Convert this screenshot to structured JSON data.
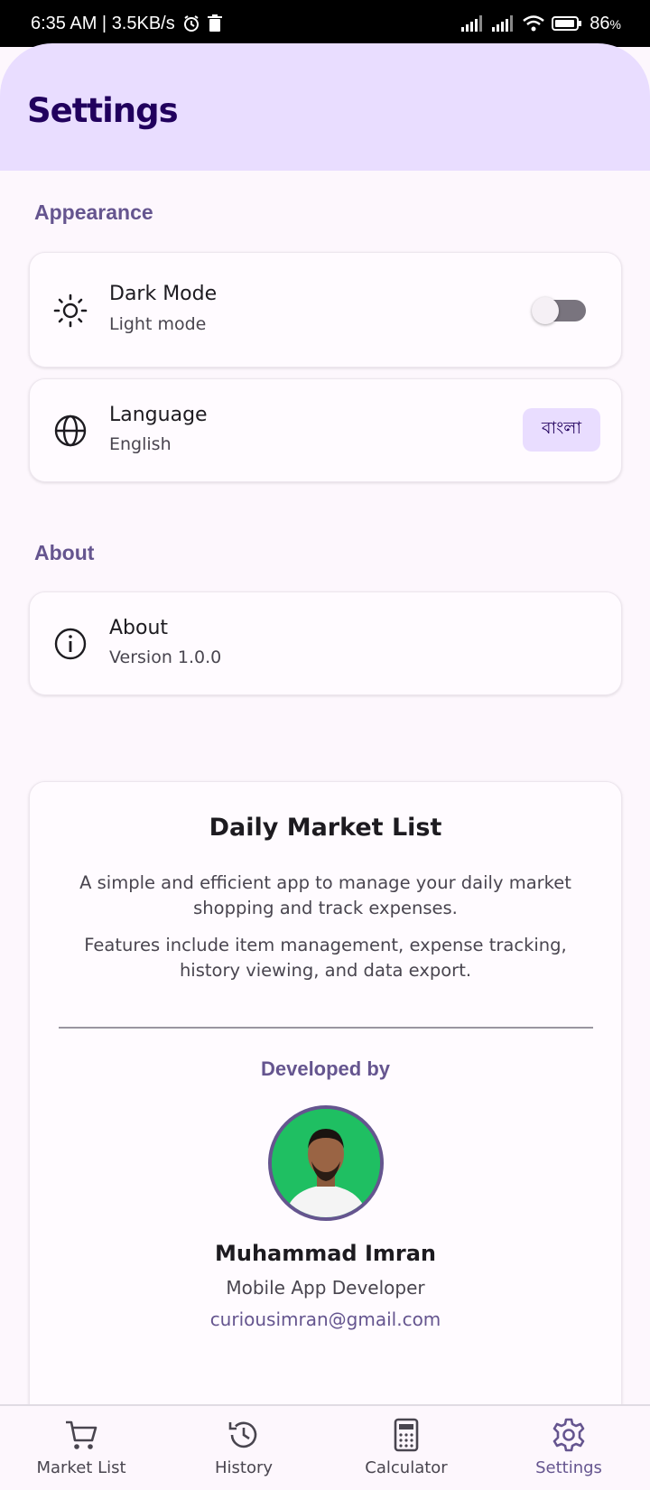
{
  "status_bar": {
    "time_speed": "6:35 AM | 3.5KB/s",
    "battery": "86"
  },
  "header": {
    "title": "Settings"
  },
  "appearance": {
    "section_title": "Appearance",
    "dark_mode": {
      "title": "Dark Mode",
      "subtitle": "Light mode",
      "icon": "sun-icon",
      "enabled": false
    },
    "language": {
      "title": "Language",
      "subtitle": "English",
      "icon": "globe-icon",
      "chip": "বাংলা"
    }
  },
  "about_section": {
    "section_title": "About",
    "about_row": {
      "title": "About",
      "subtitle": "Version 1.0.0",
      "icon": "info-icon"
    }
  },
  "app_card": {
    "name": "Daily Market List",
    "description_1": "A simple and efficient app to manage your daily market shopping and track expenses.",
    "description_2": "Features include item management, expense tracking, history viewing, and data export.",
    "developed_by": "Developed by",
    "developer_name": "Muhammad Imran",
    "developer_role": "Mobile App Developer",
    "developer_email": "curiousimran@gmail.com"
  },
  "bottom_nav": {
    "items": [
      {
        "label": "Market List",
        "icon": "cart-icon"
      },
      {
        "label": "History",
        "icon": "history-icon"
      },
      {
        "label": "Calculator",
        "icon": "calculator-icon"
      },
      {
        "label": "Settings",
        "icon": "gear-icon"
      }
    ],
    "active": "Settings"
  },
  "colors": {
    "accent": "#65558f",
    "header_bg": "#e9ddff",
    "title": "#21005d",
    "avatar_bg": "#1fbf62"
  }
}
